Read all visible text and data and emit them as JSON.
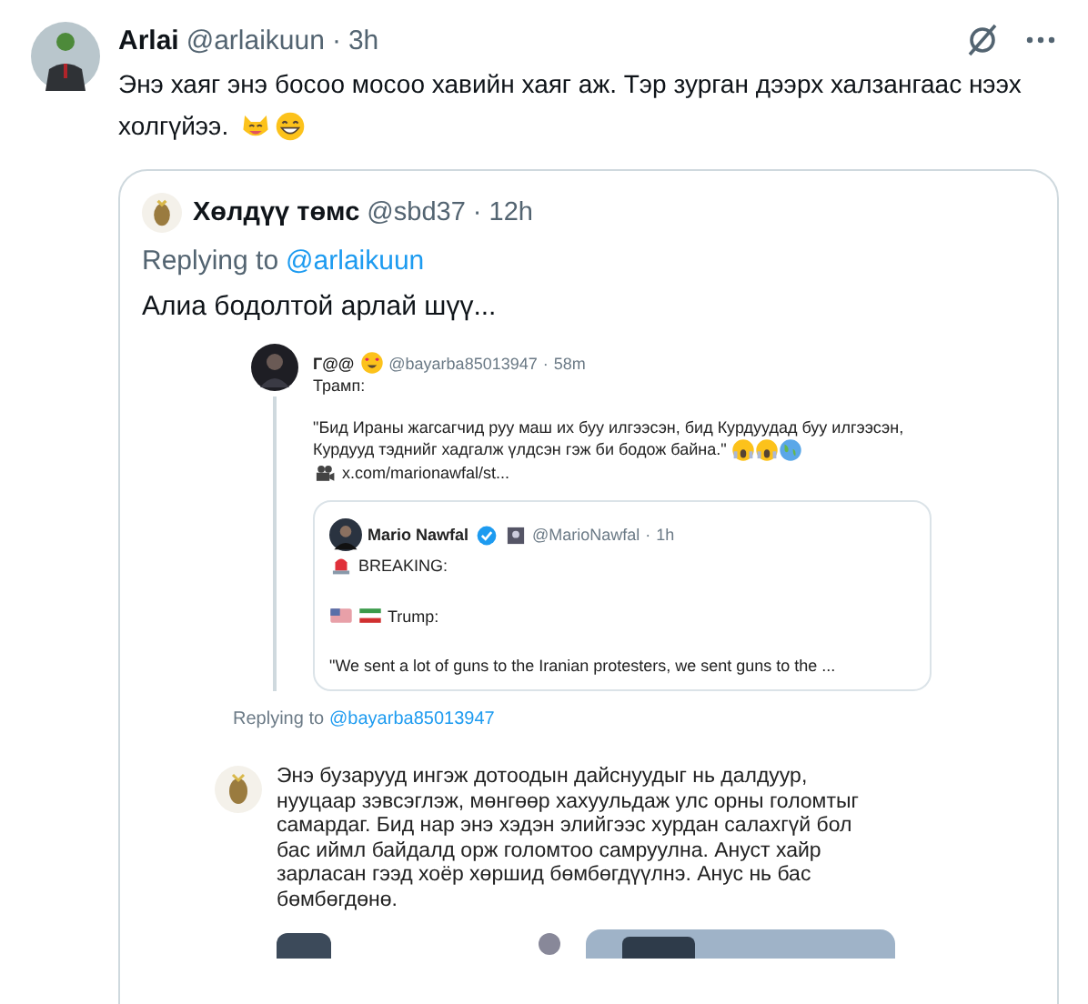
{
  "post": {
    "author": "Arlai",
    "handle": "@arlaikuun",
    "separator": "·",
    "time": "3h",
    "text_lines": [
      "Энэ хаяг энэ босоо мосоо хавийн хаяг аж. Тэр зурган дээрх халзангаас нээх",
      "холгүйээ."
    ]
  },
  "quote": {
    "author": "Хөлдүү төмс",
    "handle": "@sbd37",
    "separator": "·",
    "time": "12h",
    "replying_label": "Replying to",
    "replying_handle": "@arlaikuun",
    "text": "Алиа бодолтой арлай шүү...",
    "media": {
      "top_post": {
        "author": "Г@@",
        "handle": "@bayarba85013947",
        "separator": "·",
        "time": "58m",
        "lines": [
          "Трамп:",
          "\"Бид Ираны жагсагчид руу маш их буу илгээсэн, бид Курдуудад буу илгээсэн, Курдууд тэднийг хадгалж үлдсэн гэж би бодож байна.\""
        ],
        "link": "x.com/marionawfal/st...",
        "nested": {
          "author": "Mario Nawfal",
          "verified": true,
          "handle": "@MarioNawfal",
          "separator": "·",
          "time": "1h",
          "lines": [
            "BREAKING:",
            "Trump:",
            "\"We sent a lot of guns to the Iranian protesters, we sent guns to the ..."
          ]
        }
      },
      "replying_label": "Replying to",
      "replying_handle": "@bayarba85013947",
      "reply_text": "Энэ бузарууд ингэж дотоодын дайснуудыг нь далдуур, нууцаар зэвсэглэж, мөнгөөр хахуульдаж улс орны голомтыг самардаг. Бид нар энэ хэдэн элийгээс хурдан салахгүй бол бас иймл байдалд орж голомтоо самруулна. Ануст хайр зарласан гээд хоёр хөршид бөмбөгдүүлнэ. Анус нь бас бөмбөгдөнө."
    }
  }
}
